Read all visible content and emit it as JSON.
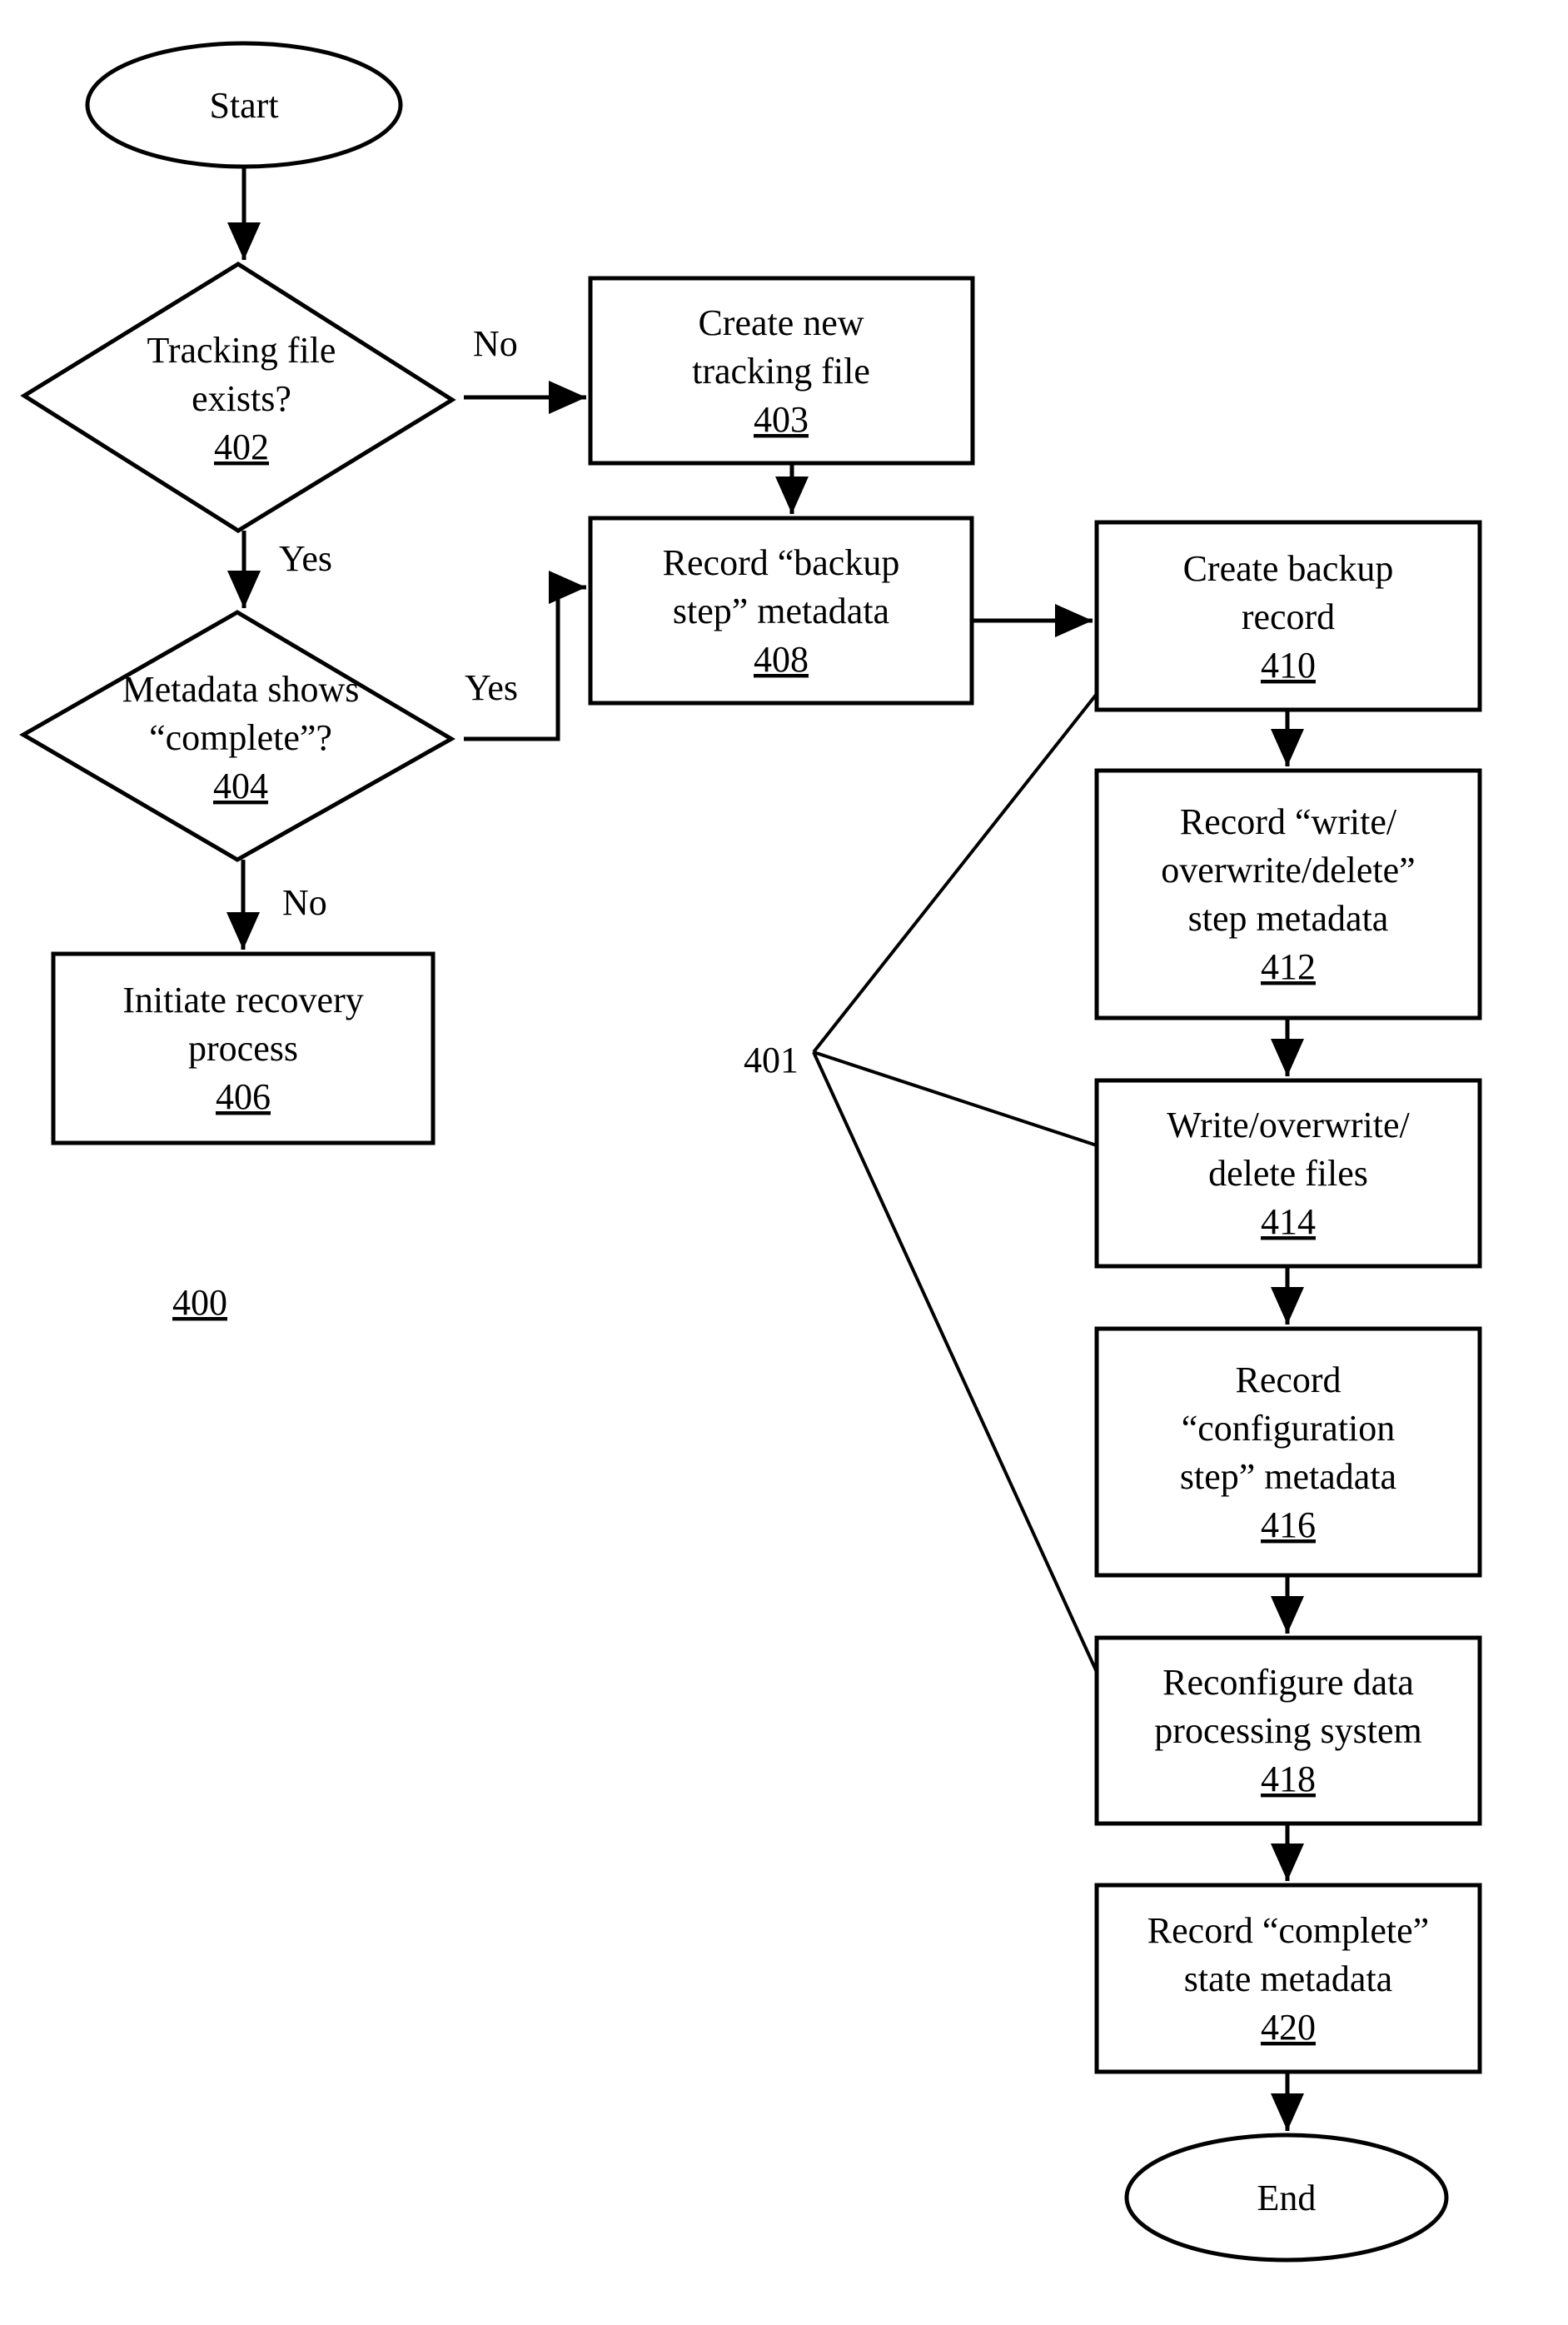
{
  "figure": {
    "label": "400",
    "group_label": "401",
    "colors": {
      "ink": "#000000",
      "background": "#ffffff"
    }
  },
  "nodes": {
    "start": {
      "type": "terminal",
      "lines": [
        "Start"
      ]
    },
    "n402": {
      "type": "decision",
      "lines": [
        "Tracking file",
        "exists?"
      ],
      "ref": "402"
    },
    "n403": {
      "type": "process",
      "lines": [
        "Create new",
        "tracking file"
      ],
      "ref": "403"
    },
    "n404": {
      "type": "decision",
      "lines": [
        "Metadata shows",
        "“complete”?"
      ],
      "ref": "404"
    },
    "n406": {
      "type": "process",
      "lines": [
        "Initiate recovery",
        "process"
      ],
      "ref": "406"
    },
    "n408": {
      "type": "process",
      "lines": [
        "Record “backup",
        "step” metadata"
      ],
      "ref": "408"
    },
    "n410": {
      "type": "process",
      "lines": [
        "Create backup",
        "record"
      ],
      "ref": "410"
    },
    "n412": {
      "type": "process",
      "lines": [
        "Record “write/",
        "overwrite/delete”",
        "step metadata"
      ],
      "ref": "412"
    },
    "n414": {
      "type": "process",
      "lines": [
        "Write/overwrite/",
        "delete files"
      ],
      "ref": "414"
    },
    "n416": {
      "type": "process",
      "lines": [
        "Record",
        "“configuration",
        "step” metadata"
      ],
      "ref": "416"
    },
    "n418": {
      "type": "process",
      "lines": [
        "Reconfigure data",
        "processing system"
      ],
      "ref": "418"
    },
    "n420": {
      "type": "process",
      "lines": [
        "Record “complete”",
        "state metadata"
      ],
      "ref": "420"
    },
    "end": {
      "type": "terminal",
      "lines": [
        "End"
      ]
    }
  },
  "edges": [
    {
      "from": "start",
      "to": "n402",
      "label": ""
    },
    {
      "from": "n402",
      "to": "n403",
      "label": "No"
    },
    {
      "from": "n402",
      "to": "n404",
      "label": "Yes"
    },
    {
      "from": "n403",
      "to": "n408",
      "label": ""
    },
    {
      "from": "n404",
      "to": "n408",
      "label": "Yes"
    },
    {
      "from": "n404",
      "to": "n406",
      "label": "No"
    },
    {
      "from": "n408",
      "to": "n410",
      "label": ""
    },
    {
      "from": "n410",
      "to": "n412",
      "label": ""
    },
    {
      "from": "n412",
      "to": "n414",
      "label": ""
    },
    {
      "from": "n414",
      "to": "n416",
      "label": ""
    },
    {
      "from": "n416",
      "to": "n418",
      "label": ""
    },
    {
      "from": "n418",
      "to": "n420",
      "label": ""
    },
    {
      "from": "n420",
      "to": "end",
      "label": ""
    }
  ],
  "group_401_members": [
    "n410",
    "n414",
    "n418"
  ]
}
